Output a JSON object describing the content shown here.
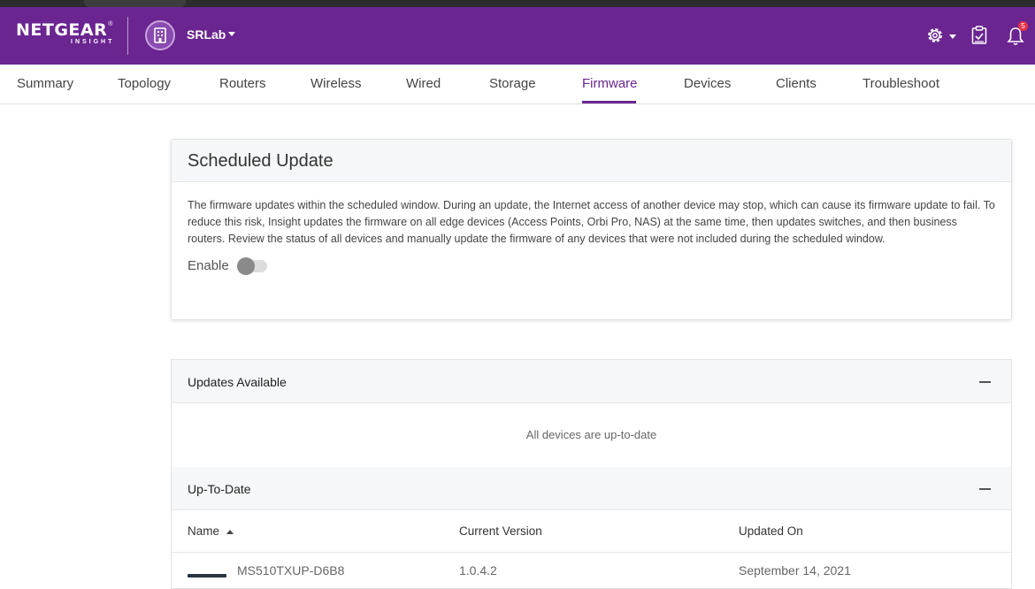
{
  "app": {
    "brand": "NETGEAR",
    "brand_sub": "INSIGHT",
    "brand_mark": "®",
    "location": "SRLab",
    "notification_count": "5",
    "accent_color": "#6a2591"
  },
  "header_icons": [
    "building-icon",
    "gear-icon",
    "clipboard-check-icon",
    "bell-icon"
  ],
  "nav": {
    "tabs": [
      "Summary",
      "Topology",
      "Routers",
      "Wireless",
      "Wired",
      "Storage",
      "Firmware",
      "Devices",
      "Clients",
      "Troubleshoot"
    ],
    "active": "Firmware"
  },
  "scheduled_update": {
    "title": "Scheduled Update",
    "description": "The firmware updates within the scheduled window. During an update, the Internet access of another device may stop, which can cause its firmware update to fail. To reduce this risk, Insight updates the firmware on all edge devices (Access Points, Orbi Pro, NAS) at the same time, then updates switches, and then business routers. Review the status of all devices and manually update the firmware of any devices that were not included during the scheduled window.",
    "enable_label": "Enable",
    "enabled": false
  },
  "updates_available": {
    "title": "Updates Available",
    "empty_message": "All devices are up-to-date"
  },
  "up_to_date": {
    "title": "Up-To-Date",
    "columns": [
      "Name",
      "Current Version",
      "Updated On"
    ],
    "rows": [
      {
        "name": "MS510TXUP-D6B8",
        "version": "1.0.4.2",
        "updated_on": "September 14, 2021"
      }
    ]
  }
}
